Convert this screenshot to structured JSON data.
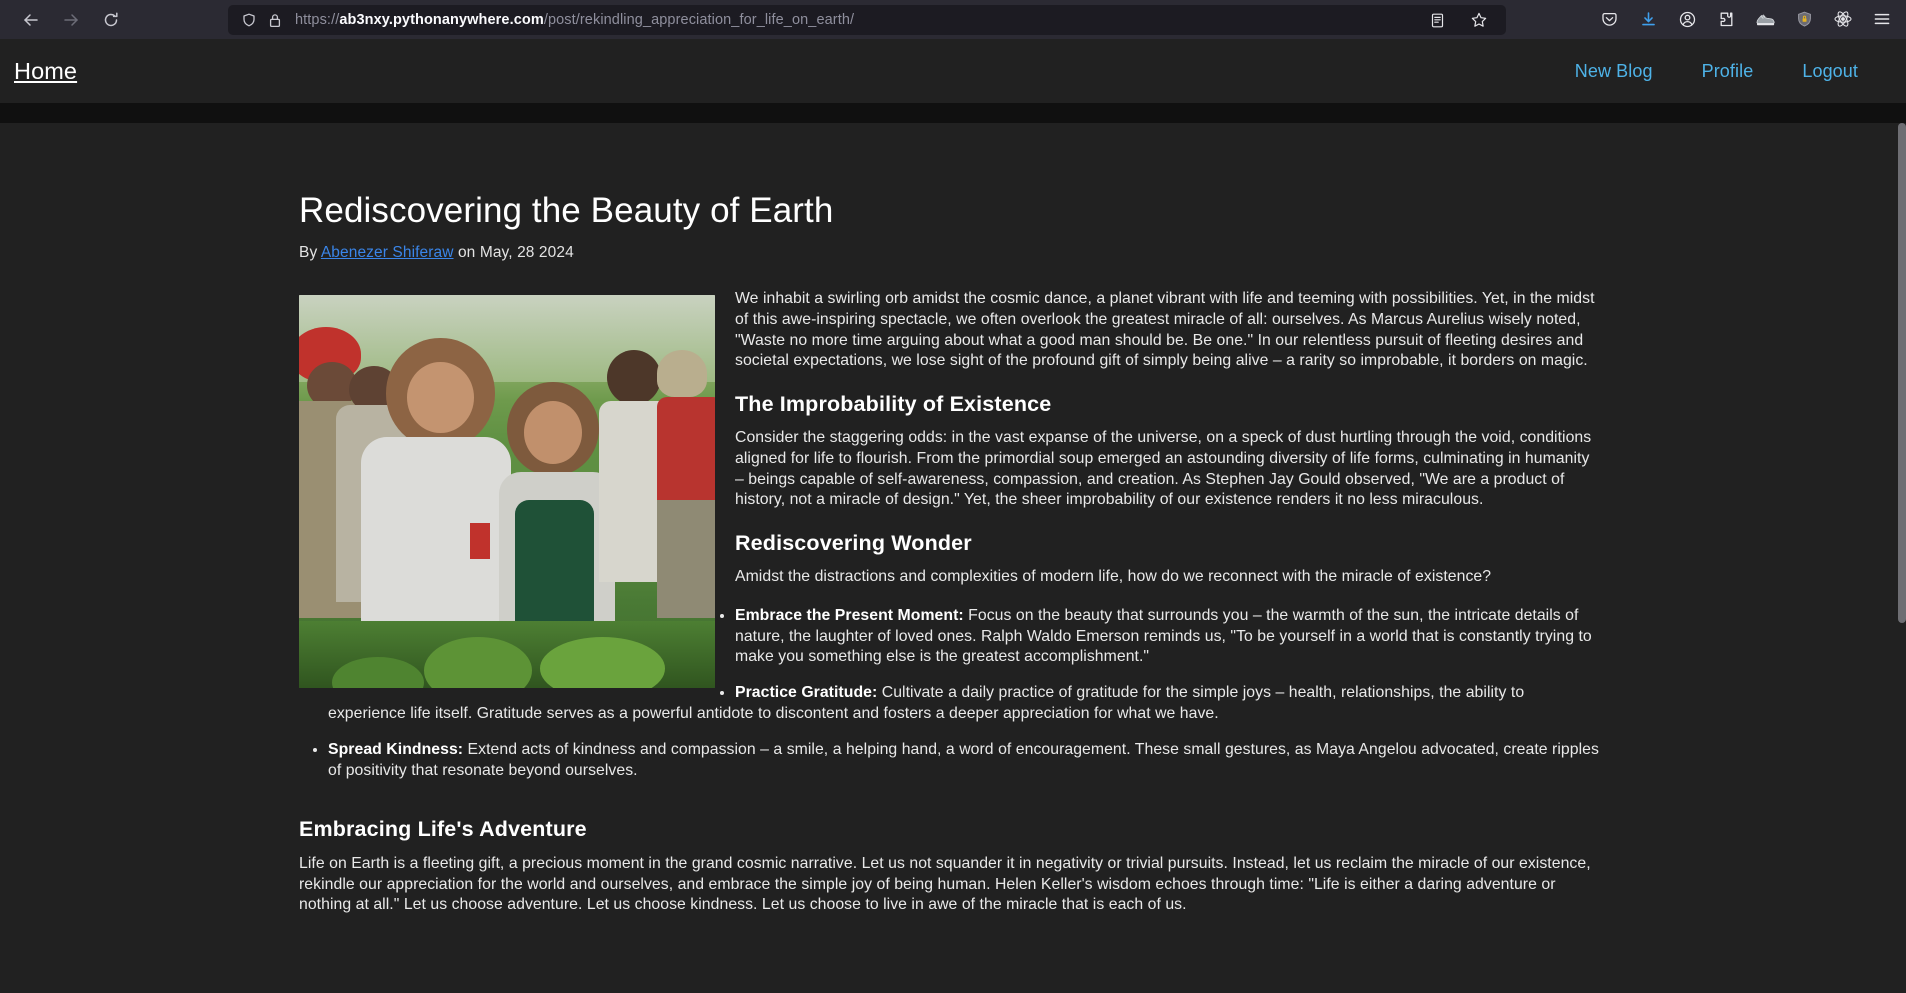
{
  "browser": {
    "back_icon": "back-arrow-icon",
    "forward_icon": "forward-arrow-icon",
    "reload_icon": "reload-icon",
    "shield_icon": "tracking-protection-shield-icon",
    "lock_icon": "padlock-icon",
    "url_prefix": "https://",
    "url_domain": "ab3nxy.pythonanywhere.com",
    "url_path": "/post/rekindling_appreciation_for_life_on_earth/",
    "url_full": "https://ab3nxy.pythonanywhere.com/post/rekindling_appreciation_for_life_on_earth/",
    "reader_icon": "reader-view-icon",
    "bookmark_icon": "star-bookmark-icon",
    "toolbar_icons": [
      "pocket-icon",
      "downloads-icon",
      "account-icon",
      "extension-puzzle-icon",
      "sneaker-extension-icon",
      "password-manager-shield-icon",
      "react-devtools-icon",
      "application-menu-icon"
    ],
    "accent_blue": "#0a84ff"
  },
  "site_nav": {
    "brand": "Home",
    "links": [
      {
        "label": "New Blog",
        "name": "nav-link-new-blog"
      },
      {
        "label": "Profile",
        "name": "nav-link-profile"
      },
      {
        "label": "Logout",
        "name": "nav-link-logout"
      }
    ],
    "link_color": "#4eb3e8"
  },
  "post": {
    "title": "Rediscovering the Beauty of Earth",
    "byline_prefix": "By",
    "author": "Abenezer Shiferaw",
    "byline_middle": "on",
    "date": "May, 28 2024",
    "image_alt": "Smiling farmers standing in a green field",
    "intro": "We inhabit a swirling orb amidst the cosmic dance, a planet vibrant with life and teeming with possibilities. Yet, in the midst of this awe-inspiring spectacle, we often overlook the greatest miracle of all: ourselves. As Marcus Aurelius wisely noted, \"Waste no more time arguing about what a good man should be. Be one.\" In our relentless pursuit of fleeting desires and societal expectations, we lose sight of the profound gift of simply being alive – a rarity so improbable, it borders on magic.",
    "sections": [
      {
        "heading": "The Improbability of Existence",
        "body": "Consider the staggering odds: in the vast expanse of the universe, on a speck of dust hurtling through the void, conditions aligned for life to flourish. From the primordial soup emerged an astounding diversity of life forms, culminating in humanity – beings capable of self-awareness, compassion, and creation. As Stephen Jay Gould observed, \"We are a product of history, not a miracle of design.\" Yet, the sheer improbability of our existence renders it no less miraculous."
      },
      {
        "heading": "Rediscovering Wonder",
        "body": "Amidst the distractions and complexities of modern life, how do we reconnect with the miracle of existence?"
      }
    ],
    "tips": [
      {
        "term": "Embrace the Present Moment:",
        "text": " Focus on the beauty that surrounds you – the warmth of the sun, the intricate details of nature, the laughter of loved ones. Ralph Waldo Emerson reminds us, \"To be yourself in a world that is constantly trying to make you something else is the greatest accomplishment.\""
      },
      {
        "term": "Practice Gratitude:",
        "text": " Cultivate a daily practice of gratitude for the simple joys – health, relationships, the ability to experience life itself. Gratitude serves as a powerful antidote to discontent and fosters a deeper appreciation for what we have."
      },
      {
        "term": "Spread Kindness:",
        "text": " Extend acts of kindness and compassion – a smile, a helping hand, a word of encouragement. These small gestures, as Maya Angelou advocated, create ripples of positivity that resonate beyond ourselves."
      }
    ],
    "closing": {
      "heading": "Embracing Life's Adventure",
      "body": "Life on Earth is a fleeting gift, a precious moment in the grand cosmic narrative. Let us not squander it in negativity or trivial pursuits. Instead, let us reclaim the miracle of our existence, rekindle our appreciation for the world and ourselves, and embrace the simple joy of being human. Helen Keller's wisdom echoes through time: \"Life is either a daring adventure or nothing at all.\" Let us choose adventure. Let us choose kindness. Let us choose to live in awe of the miracle that is each of us."
    }
  }
}
